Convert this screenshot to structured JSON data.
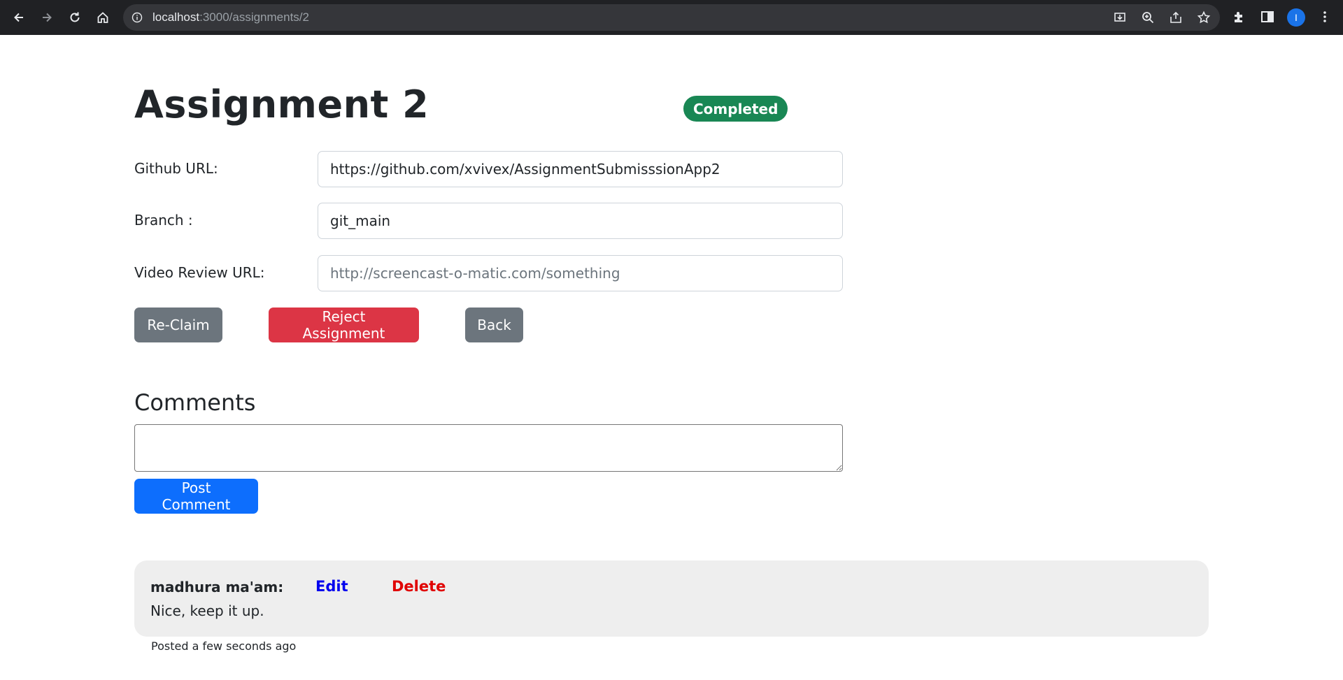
{
  "browser": {
    "url_host": "localhost",
    "url_path": ":3000/assignments/2",
    "avatar_letter": "I",
    "icons": [
      "back-arrow-icon",
      "forward-arrow-icon",
      "reload-icon",
      "home-icon",
      "info-icon",
      "install-icon",
      "zoom-icon",
      "share-icon",
      "star-icon",
      "extensions-icon",
      "side-panel-icon",
      "more-icon"
    ]
  },
  "assignment": {
    "title": "Assignment 2",
    "status": "Completed",
    "status_color": "#198754"
  },
  "form": {
    "github_label": "Github URL:",
    "github_value": "https://github.com/xvivex/AssignmentSubmisssionApp2",
    "branch_label": "Branch :",
    "branch_value": "git_main",
    "video_label": "Video Review URL:",
    "video_value": "",
    "video_placeholder": "http://screencast-o-matic.com/something"
  },
  "actions": {
    "reclaim_label": "Re-Claim",
    "reject_label": "Reject Assignment",
    "back_label": "Back"
  },
  "comments": {
    "title": "Comments",
    "input_value": "",
    "post_label": "Post Comment",
    "items": [
      {
        "author": "madhura ma'am:",
        "edit_label": "Edit",
        "delete_label": "Delete",
        "text": "Nice, keep it up.",
        "posted": "Posted a few seconds ago"
      }
    ]
  },
  "colors": {
    "primary": "#0d6efd",
    "secondary": "#6c757d",
    "danger": "#dc3545",
    "success": "#198754"
  }
}
